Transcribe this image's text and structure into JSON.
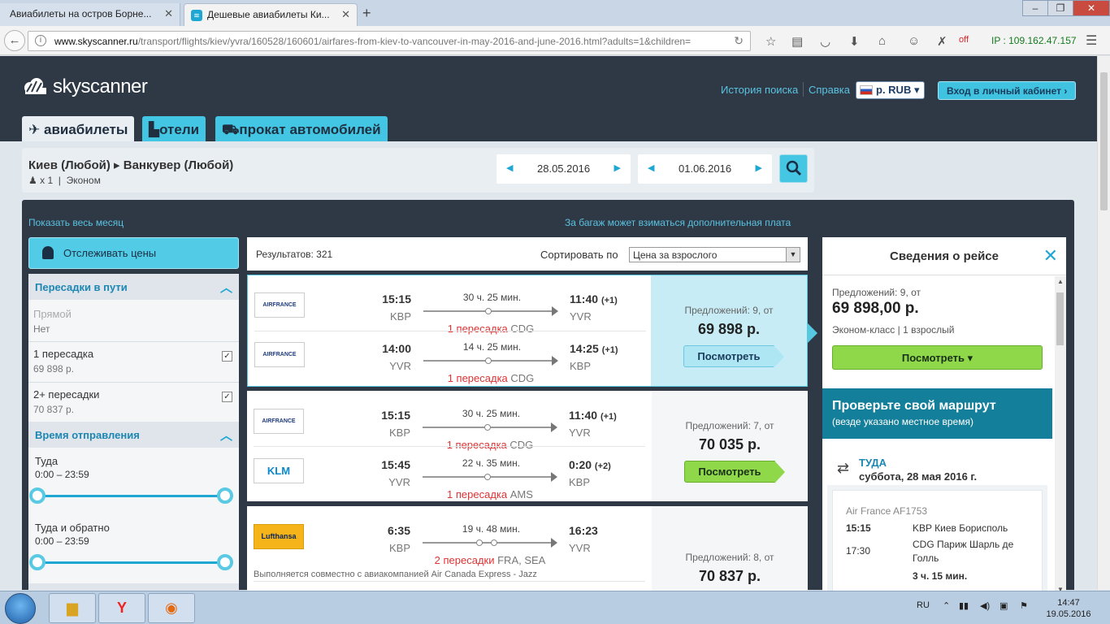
{
  "browser": {
    "tabs": [
      {
        "label": "Авиабилеты на остров Борне..."
      },
      {
        "label": "Дешевые авиабилеты Ки..."
      }
    ],
    "url_prefix": "www.skyscanner.ru",
    "url_rest": "/transport/flights/kiev/yvra/160528/160601/airfares-from-kiev-to-vancouver-in-may-2016-and-june-2016.html?adults=1&children=",
    "off_label": "off",
    "ip_label": "IP : 109.162.47.157"
  },
  "header": {
    "logo": "skyscanner",
    "history_link": "История поиска",
    "help_link": "Справка",
    "currency": "р. RUB",
    "login_button": "Вход в личный кабинет ›",
    "nav": {
      "flights": "авиабилеты",
      "hotels": "отели",
      "cars": "прокат автомобилей"
    }
  },
  "search": {
    "route": "Киев (Любой) ▸ Ванкувер (Любой)",
    "passengers": "x 1",
    "cabin": "Эконом",
    "depart_date": "28.05.2016",
    "return_date": "01.06.2016"
  },
  "links": {
    "show_month": "Показать весь месяц",
    "baggage_note": "За багаж может взиматься дополнительная плата"
  },
  "sidebar": {
    "track_button": "Отслеживать цены",
    "stops_header": "Пересадки в пути",
    "stops": [
      {
        "label": "Прямой",
        "sub": "Нет"
      },
      {
        "label": "1 пересадка",
        "sub": "69 898 р."
      },
      {
        "label": "2+ пересадки",
        "sub": "70 837 р."
      }
    ],
    "time_header": "Время отправления",
    "outbound_label": "Туда",
    "outbound_range": "0:00 – 23:59",
    "return_label": "Туда и обратно",
    "return_range": "0:00 – 23:59"
  },
  "list": {
    "results_label": "Результатов: 321",
    "sort_label": "Сортировать по",
    "sort_value": "Цена за взрослого",
    "view_label": "Посмотреть",
    "results": [
      {
        "offers": "Предложений: 9, от",
        "price": "69 898 р.",
        "legs": [
          {
            "airline": "AIRFRANCE",
            "dep": "15:15",
            "dep_code": "KBP",
            "duration": "30 ч. 25 мин.",
            "stops_text": "1 пересадка",
            "via": "CDG",
            "arr": "11:40",
            "plus": "(+1)",
            "arr_code": "YVR"
          },
          {
            "airline": "AIRFRANCE",
            "dep": "14:00",
            "dep_code": "YVR",
            "duration": "14 ч. 25 мин.",
            "stops_text": "1 пересадка",
            "via": "CDG",
            "arr": "14:25",
            "plus": "(+1)",
            "arr_code": "KBP"
          }
        ]
      },
      {
        "offers": "Предложений: 7, от",
        "price": "70 035 р.",
        "legs": [
          {
            "airline": "AIRFRANCE",
            "dep": "15:15",
            "dep_code": "KBP",
            "duration": "30 ч. 25 мин.",
            "stops_text": "1 пересадка",
            "via": "CDG",
            "arr": "11:40",
            "plus": "(+1)",
            "arr_code": "YVR"
          },
          {
            "airline": "KLM",
            "dep": "15:45",
            "dep_code": "YVR",
            "duration": "22 ч. 35 мин.",
            "stops_text": "1 пересадка",
            "via": "AMS",
            "arr": "0:20",
            "plus": "(+2)",
            "arr_code": "KBP"
          }
        ]
      },
      {
        "offers": "Предложений: 8, от",
        "price": "70 837 р.",
        "legs": [
          {
            "airline": "Lufthansa",
            "dep": "6:35",
            "dep_code": "KBP",
            "duration": "19 ч. 48 мин.",
            "stops_text": "2 пересадки",
            "via": "FRA, SEA",
            "arr": "16:23",
            "plus": "",
            "arr_code": "YVR"
          }
        ],
        "codeshare": "Выполняется совместно с авиакомпанией Air Canada Express - Jazz"
      }
    ]
  },
  "detail": {
    "title": "Сведения о рейсе",
    "offers": "Предложений: 9, от",
    "price": "69 898,00 р.",
    "class": "Эконом-класс  |  1 взрослый",
    "view_button": "Посмотреть ▾",
    "check_title": "Проверьте свой маршрут",
    "check_sub": "(везде указано местное время)",
    "leg_label": "ТУДА",
    "leg_date": "суббота, 28 мая 2016 г.",
    "flight": "Air France AF1753",
    "t1": "15:15",
    "p1": "KBP Киев Борисполь",
    "t2": "17:30",
    "p2": "CDG Париж Шарль де Голль",
    "dur": "3 ч. 15 мин."
  },
  "taskbar": {
    "lang": "RU",
    "time": "14:47",
    "date": "19.05.2016"
  }
}
